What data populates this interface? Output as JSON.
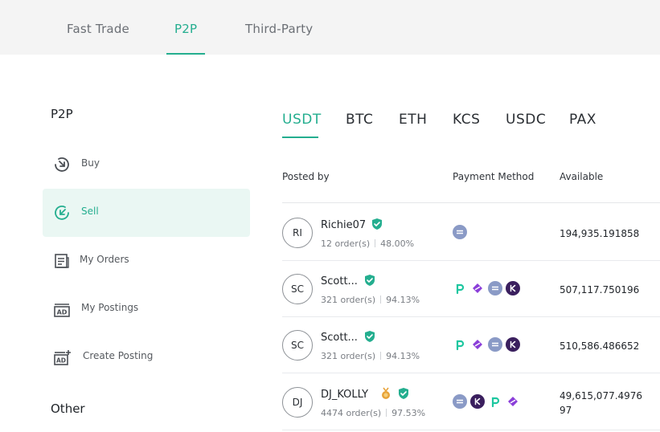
{
  "top_tabs": [
    {
      "label": "Fast Trade",
      "active": false
    },
    {
      "label": "P2P",
      "active": true
    },
    {
      "label": "Third-Party",
      "active": false
    }
  ],
  "sidebar": {
    "heading": "P2P",
    "items": [
      {
        "label": "Buy",
        "icon": "buy-arrow-icon",
        "active": false
      },
      {
        "label": "Sell",
        "icon": "sell-arrow-icon",
        "active": true
      },
      {
        "label": "My Orders",
        "icon": "orders-list-icon",
        "active": false
      },
      {
        "label": "My Postings",
        "icon": "ad-postings-icon",
        "active": false
      },
      {
        "label": "Create Posting",
        "icon": "ad-create-icon",
        "active": false
      }
    ],
    "other_heading": "Other"
  },
  "coin_tabs": [
    {
      "label": "USDT",
      "active": true
    },
    {
      "label": "BTC",
      "active": false
    },
    {
      "label": "ETH",
      "active": false
    },
    {
      "label": "KCS",
      "active": false
    },
    {
      "label": "USDC",
      "active": false
    },
    {
      "label": "PAX",
      "active": false
    }
  ],
  "table": {
    "headers": {
      "posted_by": "Posted by",
      "payment_method": "Payment Method",
      "available": "Available"
    },
    "rows": [
      {
        "initials": "RI",
        "name": "Richie07",
        "orders": "12 order(s)",
        "completion": "48.00%",
        "badges": [
          "verified-shield-icon"
        ],
        "payment_methods": [
          "bank-transfer-icon"
        ],
        "available_line1": "194,935.191858",
        "available_line2": ""
      },
      {
        "initials": "SC",
        "name": "Scott...",
        "orders": "321 order(s)",
        "completion": "94.13%",
        "badges": [
          "verified-shield-icon"
        ],
        "payment_methods": [
          "payment-p-icon",
          "payment-skrill-icon",
          "bank-transfer-icon",
          "payment-k-icon"
        ],
        "available_line1": "507,117.750196",
        "available_line2": ""
      },
      {
        "initials": "SC",
        "name": "Scott...",
        "orders": "321 order(s)",
        "completion": "94.13%",
        "badges": [
          "verified-shield-icon"
        ],
        "payment_methods": [
          "payment-p-icon",
          "payment-skrill-icon",
          "bank-transfer-icon",
          "payment-k-icon"
        ],
        "available_line1": "510,586.486652",
        "available_line2": ""
      },
      {
        "initials": "DJ",
        "name": "DJ_KOLLY",
        "orders": "4474 order(s)",
        "completion": "97.53%",
        "badges": [
          "gold-medal-icon",
          "verified-shield-icon"
        ],
        "payment_methods": [
          "bank-transfer-icon",
          "payment-k-icon",
          "payment-p-icon",
          "payment-skrill-icon"
        ],
        "available_line1": "49,615,077.4976",
        "available_line2": "97"
      }
    ]
  },
  "colors": {
    "accent": "#24ae8f",
    "accent_light_bg": "#eaf7f3",
    "top_bar_bg": "#f4f4f4",
    "bank_icon": "#8a9ac6",
    "k_icon": "#3a1f5e",
    "skrill_icon": "#8b3fd9",
    "p_icon": "#1ec7a0",
    "medal": "#e8a33a"
  }
}
